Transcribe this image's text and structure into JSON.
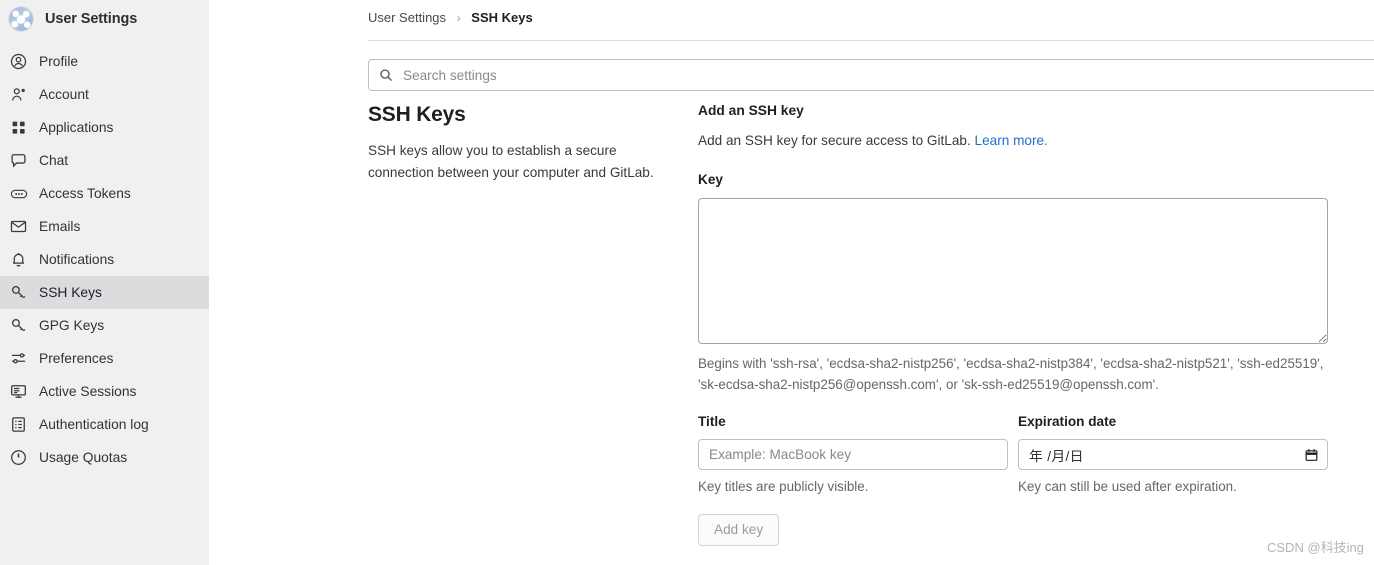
{
  "sidebar": {
    "title": "User Settings",
    "avatar_name": "user-avatar-identicon",
    "items": [
      {
        "label": "Profile",
        "icon": "profile-icon",
        "active": false
      },
      {
        "label": "Account",
        "icon": "account-icon",
        "active": false
      },
      {
        "label": "Applications",
        "icon": "applications-icon",
        "active": false
      },
      {
        "label": "Chat",
        "icon": "chat-icon",
        "active": false
      },
      {
        "label": "Access Tokens",
        "icon": "access-tokens-icon",
        "active": false
      },
      {
        "label": "Emails",
        "icon": "emails-icon",
        "active": false
      },
      {
        "label": "Notifications",
        "icon": "notifications-bell-icon",
        "active": false
      },
      {
        "label": "SSH Keys",
        "icon": "ssh-key-icon",
        "active": true
      },
      {
        "label": "GPG Keys",
        "icon": "gpg-key-icon",
        "active": false
      },
      {
        "label": "Preferences",
        "icon": "preferences-sliders-icon",
        "active": false
      },
      {
        "label": "Active Sessions",
        "icon": "active-sessions-monitor-icon",
        "active": false
      },
      {
        "label": "Authentication log",
        "icon": "authentication-log-icon",
        "active": false
      },
      {
        "label": "Usage Quotas",
        "icon": "usage-quotas-icon",
        "active": false
      }
    ]
  },
  "breadcrumb": {
    "parent": "User Settings",
    "separator": "›",
    "current": "SSH Keys"
  },
  "search": {
    "placeholder": "Search settings",
    "value": "",
    "icon": "search-icon"
  },
  "left_panel": {
    "title": "SSH Keys",
    "description": "SSH keys allow you to establish a secure connection between your computer and GitLab."
  },
  "form": {
    "heading": "Add an SSH key",
    "subtext_before_link": "Add an SSH key for secure access to GitLab. ",
    "link_label": "Learn more.",
    "key_label": "Key",
    "key_value": "",
    "key_help": "Begins with 'ssh-rsa', 'ecdsa-sha2-nistp256', 'ecdsa-sha2-nistp384', 'ecdsa-sha2-nistp521', 'ssh-ed25519', 'sk-ecdsa-sha2-nistp256@openssh.com', or 'sk-ssh-ed25519@openssh.com'.",
    "title_label": "Title",
    "title_placeholder": "Example: MacBook key",
    "title_value": "",
    "title_help": "Key titles are publicly visible.",
    "expiration_label": "Expiration date",
    "expiration_placeholder": "年 /月/日",
    "expiration_value": "",
    "expiration_help": "Key can still be used after expiration.",
    "expiration_icon": "calendar-icon",
    "submit_label": "Add key"
  },
  "watermark": "CSDN @科技ing",
  "colors": {
    "sidebar_bg": "#f0f0f0",
    "sidebar_active_bg": "#dcdcde",
    "link": "#1f6fd0",
    "text": "#1f1e24",
    "muted": "#676767",
    "border": "#bfbfc3"
  }
}
